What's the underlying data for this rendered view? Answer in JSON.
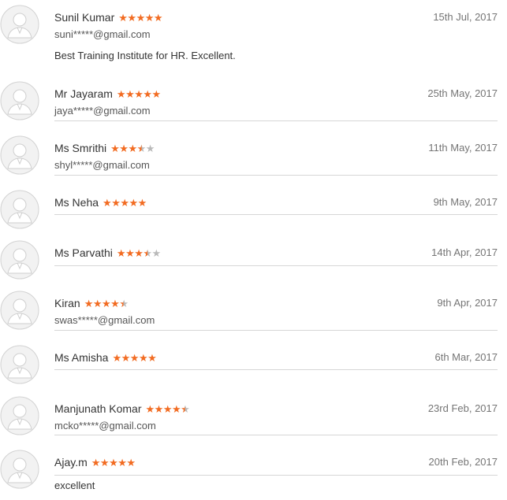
{
  "reviews": [
    {
      "name": "Sunil Kumar",
      "rating": 5,
      "date": "15th Jul, 2017",
      "email": "suni*****@gmail.com",
      "comment": "Best Training Institute for HR. Excellent."
    },
    {
      "name": "Mr Jayaram",
      "rating": 5,
      "date": "25th May, 2017",
      "email": "jaya*****@gmail.com",
      "comment": ""
    },
    {
      "name": "Ms Smrithi",
      "rating": 3.5,
      "date": "11th May, 2017",
      "email": "shyl*****@gmail.com",
      "comment": ""
    },
    {
      "name": "Ms Neha",
      "rating": 5,
      "date": "9th May, 2017",
      "email": "",
      "comment": ""
    },
    {
      "name": "Ms Parvathi",
      "rating": 3.5,
      "date": "14th Apr, 2017",
      "email": "",
      "comment": ""
    },
    {
      "name": "Kiran",
      "rating": 4.5,
      "date": "9th Apr, 2017",
      "email": "swas*****@gmail.com",
      "comment": ""
    },
    {
      "name": "Ms Amisha",
      "rating": 5,
      "date": "6th Mar, 2017",
      "email": "",
      "comment": ""
    },
    {
      "name": "Manjunath Komar",
      "rating": 4.5,
      "date": "23rd Feb, 2017",
      "email": "mcko*****@gmail.com",
      "comment": ""
    },
    {
      "name": "Ajay.m",
      "rating": 5,
      "date": "20th Feb, 2017",
      "email": "",
      "comment": "excellent"
    }
  ],
  "colors": {
    "star_filled": "#f26b21",
    "star_empty": "#b9b9b9",
    "divider": "#d6d6d6"
  },
  "icons": {
    "avatar": "user-avatar-icon",
    "star": "star-icon"
  }
}
